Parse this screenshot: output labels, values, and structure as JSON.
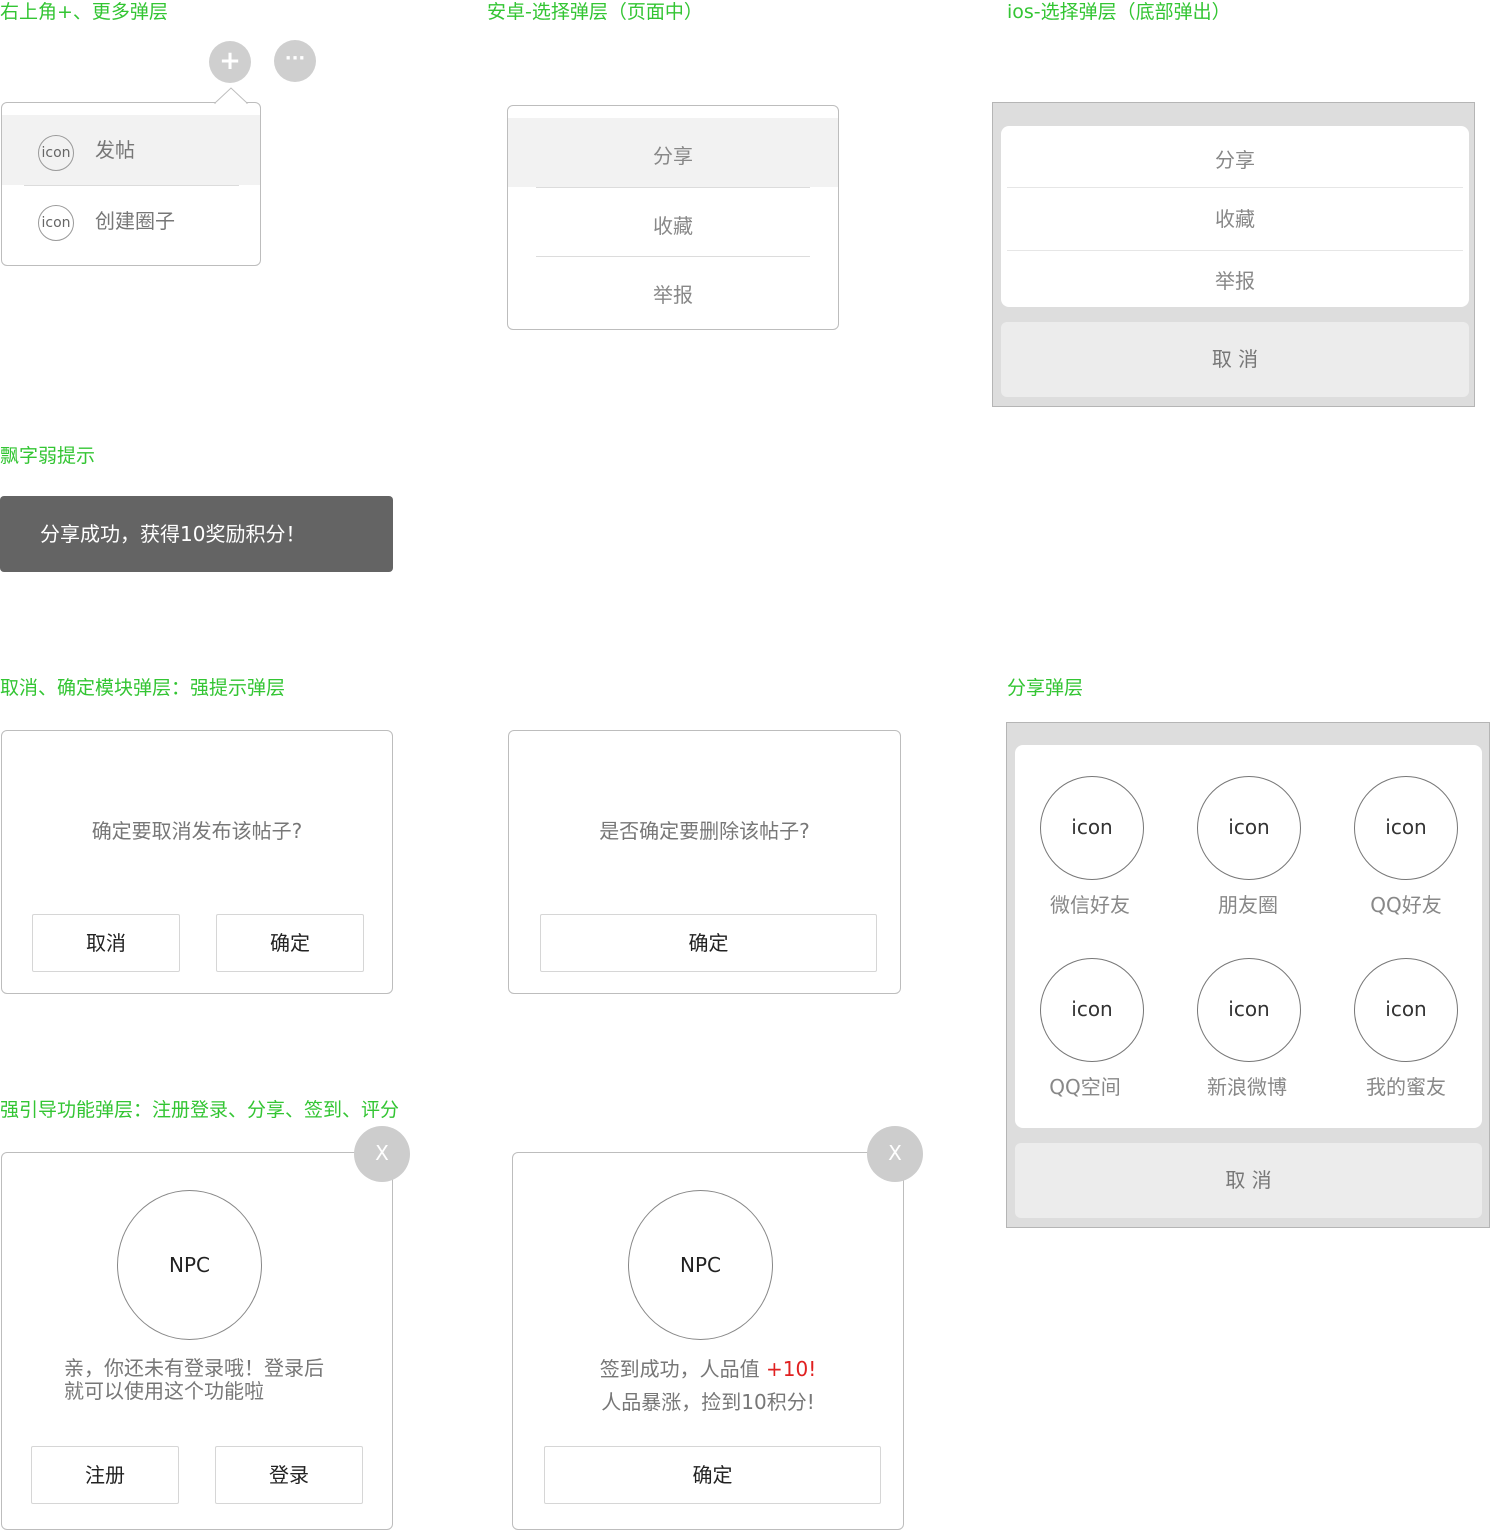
{
  "sections": {
    "top_right_menu": "右上角+、更多弹层",
    "android_select": "安卓-选择弹层（页面中）",
    "ios_select": "ios-选择弹层（底部弹出）",
    "toast": "飘字弱提示",
    "confirm_dialogs": "取消、确定模块弹层：强提示弹层",
    "share_sheet": "分享弹层",
    "guide_dialogs": "强引导功能弹层：注册登录、分享、签到、评分"
  },
  "top_menu": {
    "plus_glyph": "+",
    "more_glyph": "···",
    "items": [
      {
        "icon": "icon",
        "label": "发帖"
      },
      {
        "icon": "icon",
        "label": "创建圈子"
      }
    ]
  },
  "android_menu": {
    "items": [
      "分享",
      "收藏",
      "举报"
    ]
  },
  "ios_menu": {
    "items": [
      "分享",
      "收藏",
      "举报"
    ],
    "cancel": "取 消"
  },
  "toast": {
    "text": "分享成功，获得10奖励积分！"
  },
  "confirm_dialog_1": {
    "message": "确定要取消发布该帖子?",
    "cancel": "取消",
    "ok": "确定"
  },
  "confirm_dialog_2": {
    "message": "是否确定要删除该帖子?",
    "ok": "确定"
  },
  "share_sheet": {
    "items": [
      {
        "icon": "icon",
        "label": "微信好友"
      },
      {
        "icon": "icon",
        "label": "朋友圈"
      },
      {
        "icon": "icon",
        "label": "QQ好友"
      },
      {
        "icon": "icon",
        "label": "QQ空间"
      },
      {
        "icon": "icon",
        "label": "新浪微博"
      },
      {
        "icon": "icon",
        "label": "我的蜜友"
      }
    ],
    "cancel": "取 消"
  },
  "guide_dialog_login": {
    "close": "X",
    "avatar": "NPC",
    "message_line1": "亲，你还未有登录哦！登录后",
    "message_line2": "就可以使用这个功能啦",
    "register": "注册",
    "login": "登录"
  },
  "guide_dialog_checkin": {
    "close": "X",
    "avatar": "NPC",
    "line1_prefix": "签到成功，人品值 ",
    "line1_highlight": "+10",
    "line1_suffix": "!",
    "line2": "人品暴涨，捡到10积分!",
    "ok": "确定",
    "highlight_color": "#e02020"
  },
  "colors": {
    "section_title": "#33c533",
    "toast_bg": "#646464",
    "accent_red": "#e02020"
  }
}
